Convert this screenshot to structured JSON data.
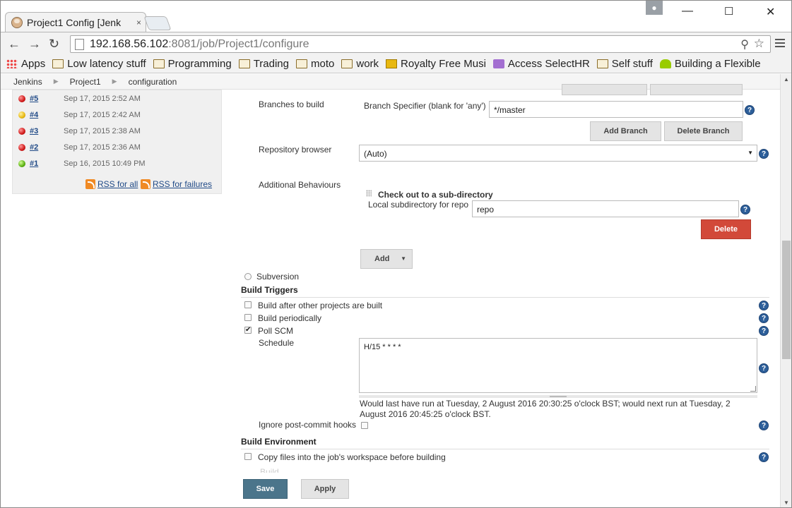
{
  "browser": {
    "tab_title": "Project1 Config [Jenk",
    "tab_close": "×",
    "profile_icon": "person-icon",
    "url_host": "192.168.56.102",
    "url_path": ":8081/job/Project1/configure",
    "window_controls": {
      "minimize": "—",
      "maximize": "☐",
      "close": "✕"
    },
    "nav": {
      "back": "←",
      "forward": "→",
      "reload": "↻"
    },
    "bookmarks": [
      {
        "label": "Apps",
        "icon": "apps-icon"
      },
      {
        "label": "Low latency stuff",
        "icon": "folder-icon"
      },
      {
        "label": "Programming",
        "icon": "folder-icon"
      },
      {
        "label": "Trading",
        "icon": "folder-icon"
      },
      {
        "label": "moto",
        "icon": "folder-icon"
      },
      {
        "label": "work",
        "icon": "folder-icon"
      },
      {
        "label": "Royalty Free Musi",
        "icon": "play-icon"
      },
      {
        "label": "Access SelectHR",
        "icon": "selecthr-icon"
      },
      {
        "label": "Self stuff",
        "icon": "folder-icon"
      },
      {
        "label": "Building a Flexible",
        "icon": "android-icon"
      }
    ]
  },
  "breadcrumbs": [
    "Jenkins",
    "Project1",
    "configuration"
  ],
  "history": {
    "builds": [
      {
        "num": "#5",
        "date": "Sep 17, 2015 2:52 AM",
        "status": "red"
      },
      {
        "num": "#4",
        "date": "Sep 17, 2015 2:42 AM",
        "status": "yellow"
      },
      {
        "num": "#3",
        "date": "Sep 17, 2015 2:38 AM",
        "status": "red"
      },
      {
        "num": "#2",
        "date": "Sep 17, 2015 2:36 AM",
        "status": "red"
      },
      {
        "num": "#1",
        "date": "Sep 16, 2015 10:49 PM",
        "status": "green"
      }
    ],
    "rss_all": "RSS for all",
    "rss_failures": "RSS for failures"
  },
  "scm": {
    "branches_label": "Branches to build",
    "branch_specifier_label": "Branch Specifier (blank for 'any')",
    "branch_specifier_value": "*/master",
    "add_branch": "Add Branch",
    "delete_branch": "Delete Branch",
    "repo_browser_label": "Repository browser",
    "repo_browser_value": "(Auto)",
    "additional_behaviours_label": "Additional Behaviours",
    "checkout_subdir_title": "Check out to a sub-directory",
    "local_subdir_label": "Local subdirectory for repo",
    "local_subdir_value": "repo",
    "delete": "Delete",
    "add": "Add",
    "subversion_label": "Subversion"
  },
  "build_triggers": {
    "title": "Build Triggers",
    "after_other": "Build after other projects are built",
    "periodically": "Build periodically",
    "poll_scm": "Poll SCM",
    "schedule_label": "Schedule",
    "schedule_value": "H/15 * * * *",
    "schedule_info_1": "Would last have run at Tuesday, 2 August 2016 20:30:25 o'clock BST; would next run at Tuesday, 2",
    "schedule_info_2": "August 2016 20:45:25 o'clock BST.",
    "ignore_hooks": "Ignore post-commit hooks"
  },
  "build_env": {
    "title": "Build Environment",
    "copy_files": "Copy files into the job's workspace before building",
    "cut_off": "Build"
  },
  "actions": {
    "save": "Save",
    "apply": "Apply"
  },
  "help_glyph": "?"
}
